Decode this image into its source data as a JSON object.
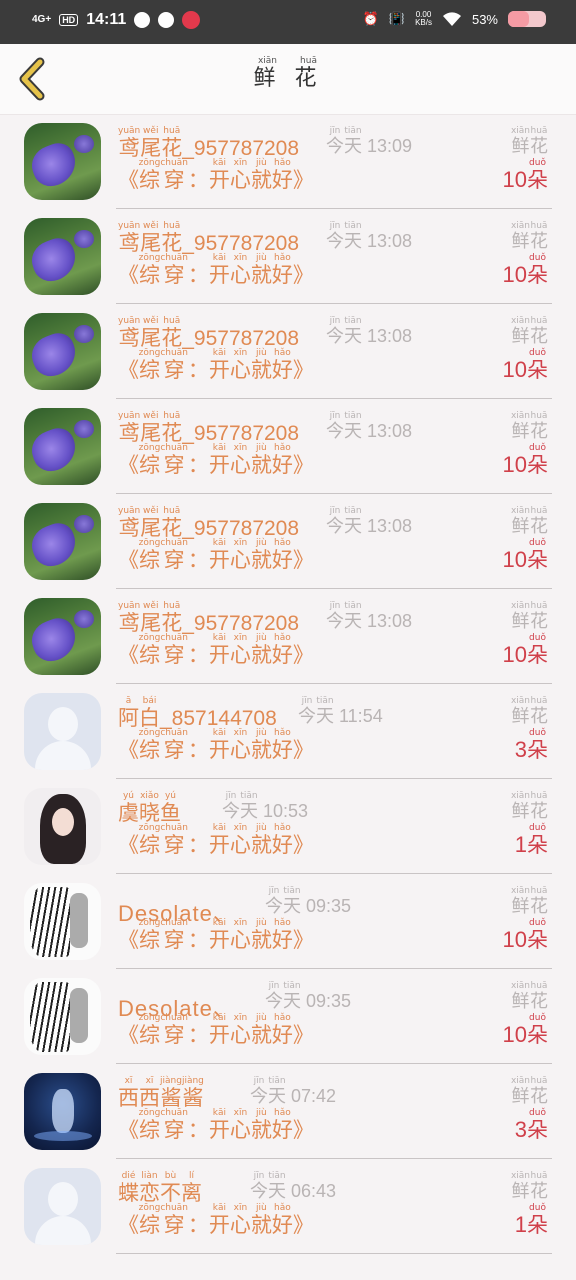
{
  "status_bar": {
    "network": "4G+",
    "hd": "HD",
    "time": "14:11",
    "speed_value": "0.00",
    "speed_unit": "KB/s",
    "battery": "53%"
  },
  "header": {
    "title": [
      {
        "char": "鲜",
        "py": "xiān"
      },
      {
        "char": "花",
        "py": "huā"
      }
    ]
  },
  "gift_label": [
    {
      "char": "鲜",
      "py": "xiān"
    },
    {
      "char": "花",
      "py": "huā"
    }
  ],
  "unit": {
    "char": "朵",
    "py": "duǒ"
  },
  "today": [
    {
      "char": "今",
      "py": "jīn"
    },
    {
      "char": "天",
      "py": "tiān"
    }
  ],
  "message": {
    "open": "《",
    "parts": [
      {
        "char": "综",
        "py": "zōng"
      },
      {
        "char": "穿",
        "py": "chuān"
      },
      {
        "char": "：",
        "py": ""
      },
      {
        "char": "开",
        "py": "kāi"
      },
      {
        "char": "心",
        "py": "xīn"
      },
      {
        "char": "就",
        "py": "jiù"
      },
      {
        "char": "好",
        "py": "hǎo"
      }
    ],
    "close": "》"
  },
  "rows": [
    {
      "avatar": "iris-flower",
      "name": [
        {
          "char": "鸢",
          "py": "yuān"
        },
        {
          "char": "尾",
          "py": "wěi"
        },
        {
          "char": "花",
          "py": "huā"
        }
      ],
      "suffix": "_957787208",
      "time": "13:09",
      "count": "10"
    },
    {
      "avatar": "iris-flower",
      "name": [
        {
          "char": "鸢",
          "py": "yuān"
        },
        {
          "char": "尾",
          "py": "wěi"
        },
        {
          "char": "花",
          "py": "huā"
        }
      ],
      "suffix": "_957787208",
      "time": "13:08",
      "count": "10"
    },
    {
      "avatar": "iris-flower",
      "name": [
        {
          "char": "鸢",
          "py": "yuān"
        },
        {
          "char": "尾",
          "py": "wěi"
        },
        {
          "char": "花",
          "py": "huā"
        }
      ],
      "suffix": "_957787208",
      "time": "13:08",
      "count": "10"
    },
    {
      "avatar": "iris-flower",
      "name": [
        {
          "char": "鸢",
          "py": "yuān"
        },
        {
          "char": "尾",
          "py": "wěi"
        },
        {
          "char": "花",
          "py": "huā"
        }
      ],
      "suffix": "_957787208",
      "time": "13:08",
      "count": "10"
    },
    {
      "avatar": "iris-flower",
      "name": [
        {
          "char": "鸢",
          "py": "yuān"
        },
        {
          "char": "尾",
          "py": "wěi"
        },
        {
          "char": "花",
          "py": "huā"
        }
      ],
      "suffix": "_957787208",
      "time": "13:08",
      "count": "10"
    },
    {
      "avatar": "iris-flower",
      "name": [
        {
          "char": "鸢",
          "py": "yuān"
        },
        {
          "char": "尾",
          "py": "wěi"
        },
        {
          "char": "花",
          "py": "huā"
        }
      ],
      "suffix": "_957787208",
      "time": "13:08",
      "count": "10"
    },
    {
      "avatar": "default-user",
      "name": [
        {
          "char": "阿",
          "py": "ā"
        },
        {
          "char": "白",
          "py": "bái"
        }
      ],
      "suffix": "_857144708",
      "time": "11:54",
      "count": "3"
    },
    {
      "avatar": "girl-portrait",
      "name": [
        {
          "char": "虞",
          "py": "yú"
        },
        {
          "char": "晓",
          "py": "xiǎo"
        },
        {
          "char": "鱼",
          "py": "yú"
        }
      ],
      "suffix": "",
      "time": "10:53",
      "count": "1"
    },
    {
      "avatar": "sketch-figure",
      "latin": "Desolate、",
      "time": "09:35",
      "count": "10"
    },
    {
      "avatar": "sketch-figure",
      "latin": "Desolate、",
      "time": "09:35",
      "count": "10"
    },
    {
      "avatar": "spirit-deer",
      "name": [
        {
          "char": "西",
          "py": "xī"
        },
        {
          "char": "西",
          "py": "xī"
        },
        {
          "char": "酱",
          "py": "jiàng"
        },
        {
          "char": "酱",
          "py": "jiàng"
        }
      ],
      "suffix": "",
      "time": "07:42",
      "count": "3"
    },
    {
      "avatar": "default-user",
      "name": [
        {
          "char": "蝶",
          "py": "dié"
        },
        {
          "char": "恋",
          "py": "liàn"
        },
        {
          "char": "不",
          "py": "bù"
        },
        {
          "char": "离",
          "py": "lí"
        }
      ],
      "suffix": "",
      "time": "06:43",
      "count": "1"
    }
  ],
  "colors": {
    "accent_orange": "#e08a53",
    "count_red": "#d0404a",
    "muted_gray": "#b9b4b4",
    "back_arrow": "#e6c34a"
  }
}
